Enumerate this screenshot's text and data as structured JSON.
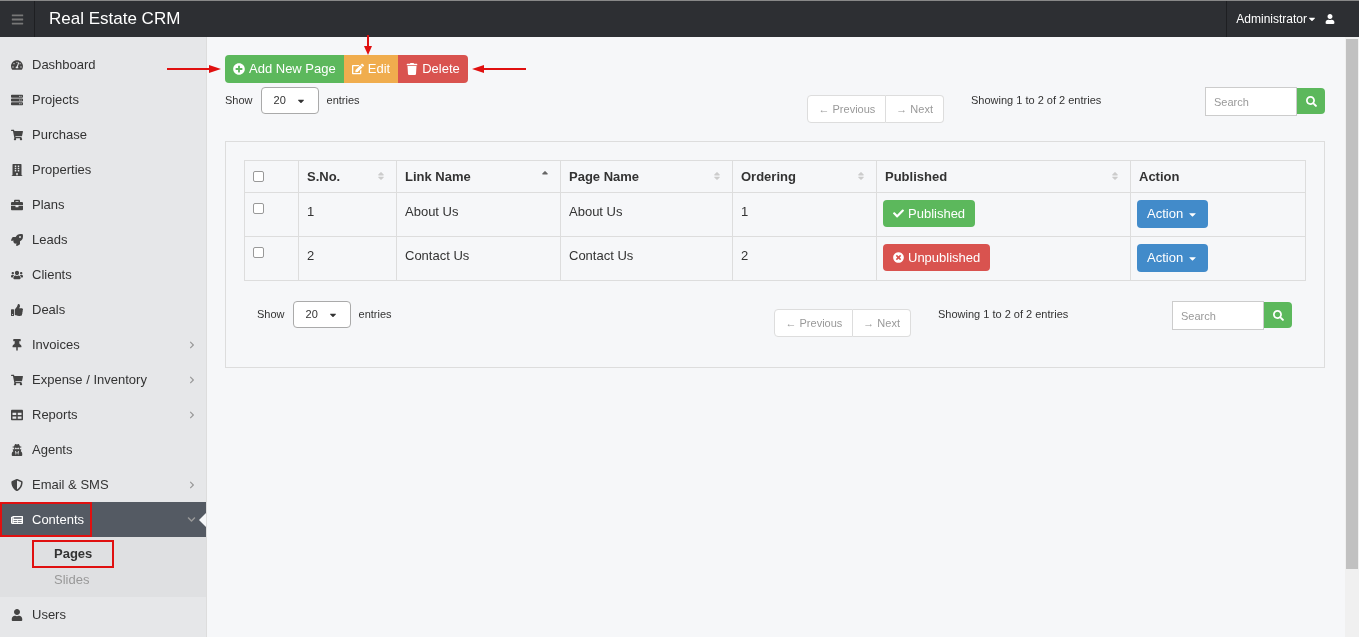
{
  "app": {
    "title": "Real Estate CRM",
    "user": "Administrator"
  },
  "sidebar": {
    "items": [
      {
        "label": "Dashboard",
        "has_submenu": false,
        "expanded": false,
        "highlighted": false
      },
      {
        "label": "Projects",
        "has_submenu": false,
        "expanded": false,
        "highlighted": false
      },
      {
        "label": "Purchase",
        "has_submenu": false,
        "expanded": false,
        "highlighted": false
      },
      {
        "label": "Properties",
        "has_submenu": false,
        "expanded": false,
        "highlighted": false
      },
      {
        "label": "Plans",
        "has_submenu": false,
        "expanded": false,
        "highlighted": false
      },
      {
        "label": "Leads",
        "has_submenu": false,
        "expanded": false,
        "highlighted": false
      },
      {
        "label": "Clients",
        "has_submenu": false,
        "expanded": false,
        "highlighted": false
      },
      {
        "label": "Deals",
        "has_submenu": false,
        "expanded": false,
        "highlighted": false
      },
      {
        "label": "Invoices",
        "has_submenu": true,
        "expanded": false,
        "highlighted": false
      },
      {
        "label": "Expense / Inventory",
        "has_submenu": true,
        "expanded": false,
        "highlighted": false
      },
      {
        "label": "Reports",
        "has_submenu": true,
        "expanded": false,
        "highlighted": false
      },
      {
        "label": "Agents",
        "has_submenu": false,
        "expanded": false,
        "highlighted": false
      },
      {
        "label": "Email & SMS",
        "has_submenu": true,
        "expanded": false,
        "highlighted": false
      },
      {
        "label": "Contents",
        "has_submenu": true,
        "expanded": true,
        "highlighted": true,
        "children": [
          {
            "label": "Pages",
            "selected": true,
            "highlighted": true
          },
          {
            "label": "Slides",
            "selected": false,
            "highlighted": false
          }
        ]
      },
      {
        "label": "Users",
        "has_submenu": false,
        "expanded": false,
        "highlighted": false
      }
    ]
  },
  "toolbar": {
    "buttons": [
      {
        "label": "Add New Page",
        "kind": "add"
      },
      {
        "label": "Edit",
        "kind": "edit"
      },
      {
        "label": "Delete",
        "kind": "delete"
      }
    ]
  },
  "top_controls": {
    "show_label": "Show",
    "page_size": "20",
    "entries_label": "entries",
    "previous": {
      "label": "← Previous",
      "disabled": true
    },
    "next": {
      "label": "→ Next",
      "disabled": true
    },
    "info": "Showing 1 to 2 of 2 entries",
    "search_placeholder": "Search"
  },
  "table": {
    "columns": [
      {
        "kind": "checkbox",
        "checked": false,
        "sortable": false
      },
      {
        "label": "S.No.",
        "sortable": true,
        "sorted_ascending": false,
        "kind": "text"
      },
      {
        "label": "Link Name",
        "sortable": true,
        "sorted_ascending": true,
        "kind": "text"
      },
      {
        "label": "Page Name",
        "sortable": true,
        "sorted_ascending": false,
        "kind": "text"
      },
      {
        "label": "Ordering",
        "sortable": true,
        "sorted_ascending": false,
        "kind": "text"
      },
      {
        "label": "Published",
        "sortable": true,
        "sorted_ascending": false,
        "kind": "text"
      },
      {
        "label": "Action",
        "sortable": false,
        "kind": "text"
      }
    ],
    "rows": [
      {
        "checked": false,
        "sno": "1",
        "link_name": "About Us",
        "page_name": "About Us",
        "ordering": "1",
        "published": true,
        "status": "Published",
        "action": "Action"
      },
      {
        "checked": false,
        "sno": "2",
        "link_name": "Contact Us",
        "page_name": "Contact Us",
        "ordering": "2",
        "published": false,
        "status": "Unpublished",
        "action": "Action"
      }
    ]
  },
  "bottom_controls": {
    "show_label": "Show",
    "page_size": "20",
    "entries_label": "entries",
    "previous": {
      "label": "← Previous",
      "disabled": true
    },
    "next": {
      "label": "→ Next",
      "disabled": true
    },
    "info": "Showing 1 to 2 of 2 entries",
    "search_placeholder": "Search"
  }
}
